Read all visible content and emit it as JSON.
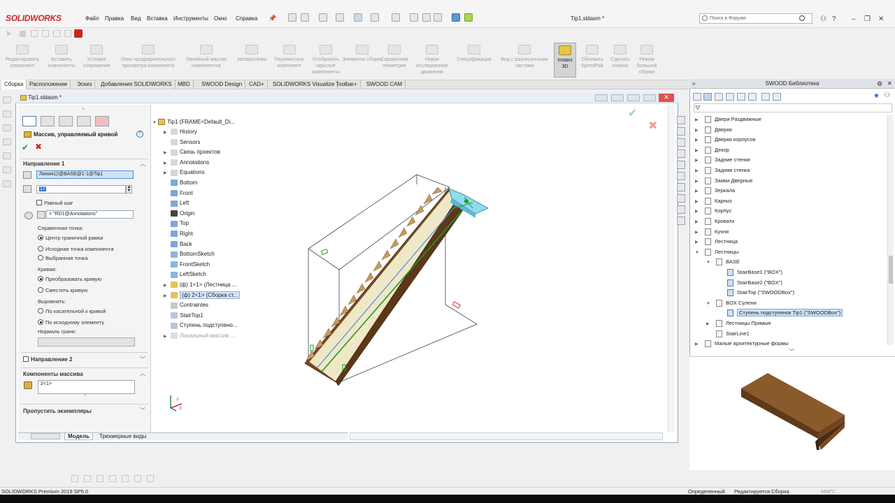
{
  "app": {
    "brand": "SOLIDWORKS",
    "doc_title": "Tip1.sldasm *",
    "menus": [
      "Файл",
      "Правка",
      "Вид",
      "Вставка",
      "Инструменты",
      "Окно",
      "Справка"
    ],
    "search_placeholder": "Поиск в Форуме"
  },
  "command_manager": {
    "buttons": [
      "Редактировать компонент",
      "Вставить компоненты",
      "Условия сопряжения",
      "Окно предварительного просмотра компонента",
      "Линейный массив компонентов",
      "Автокрепежи",
      "Переместить компонент",
      "Отобразить скрытые компоненты",
      "Элементы сборки",
      "Справочная геометрия",
      "Новое исследование движения",
      "Спецификация",
      "Вид с разнесенными частями",
      "Instant 3D",
      "Обновить SpeedPak",
      "Сделать снимок",
      "Режим большой сборки"
    ],
    "active": "Instant 3D"
  },
  "tabs": [
    "Сборка",
    "Расположение",
    "Эскиз",
    "Добавления SOLIDWORKS",
    "MBD",
    "SWOOD Design",
    "CAD+",
    "SOLIDWORKS Visualize",
    "Toolbar+",
    "SWOOD CAM"
  ],
  "active_tab": "Сборка",
  "doc_window": {
    "title": "Tip1.sldasm *"
  },
  "property_manager": {
    "title": "Массив, управляемый кривой",
    "direction1": {
      "label": "Направление 1",
      "curve": "Линия12@BASE@1-1@Tip1",
      "count": "17",
      "equal_spacing": "Равный шаг",
      "equal_spacing_checked": false,
      "distance_value": "= \"RD1@Annotations\"",
      "reference_point_label": "Справочная точка:",
      "ref_options": [
        "Центр граничной рамки",
        "Исходная точка компонента",
        "Выбранная точка"
      ],
      "ref_selected": 0,
      "curve_label": "Кривая:",
      "curve_options": [
        "Преобразовать кривую",
        "Сместить кривую"
      ],
      "curve_selected": 0,
      "align_label": "Выровнять:",
      "align_options": [
        "По касательной к кривой",
        "По исходному элементу"
      ],
      "align_selected": 1,
      "face_normal_label": "Нормаль грани:"
    },
    "direction2": {
      "label": "Направление 2",
      "checked": false
    },
    "components": {
      "label": "Компоненты массива",
      "value": "2<1>"
    },
    "skip": {
      "label": "Пропустить экземпляры"
    }
  },
  "feature_tree": {
    "root": "Tip1  (FRAME<Default_Di...",
    "items": [
      {
        "label": "History",
        "expand": true,
        "icon": "history"
      },
      {
        "label": "Sensors",
        "expand": false,
        "icon": "sensor"
      },
      {
        "label": "Связь проектов",
        "expand": true,
        "icon": "link"
      },
      {
        "label": "Annotations",
        "expand": true,
        "icon": "annotation"
      },
      {
        "label": "Equations",
        "expand": true,
        "icon": "equation"
      },
      {
        "label": "Bottom",
        "expand": false,
        "icon": "plane"
      },
      {
        "label": "Front",
        "expand": false,
        "icon": "plane"
      },
      {
        "label": "Left",
        "expand": false,
        "icon": "plane"
      },
      {
        "label": "Origin",
        "expand": false,
        "icon": "origin"
      },
      {
        "label": "Top",
        "expand": false,
        "icon": "plane"
      },
      {
        "label": "Right",
        "expand": false,
        "icon": "plane"
      },
      {
        "label": "Back",
        "expand": false,
        "icon": "plane"
      },
      {
        "label": "BottomSketch",
        "expand": false,
        "icon": "sketch"
      },
      {
        "label": "FrontSketch",
        "expand": false,
        "icon": "sketch"
      },
      {
        "label": "LeftSketch",
        "expand": false,
        "icon": "sketch"
      },
      {
        "label": "(ф) 1<1> (Лестница ...",
        "expand": true,
        "icon": "assembly"
      },
      {
        "label": "(ф) 2<1> (Сборка ст...",
        "expand": true,
        "icon": "assembly",
        "selected": true
      },
      {
        "label": "Contraintes",
        "expand": false,
        "icon": "mate"
      },
      {
        "label": "StairTop1",
        "expand": false,
        "icon": "part"
      },
      {
        "label": "Ступень подступено...",
        "expand": false,
        "icon": "part"
      },
      {
        "label": "Локальный массив ...",
        "expand": true,
        "icon": "pattern",
        "dim": true
      }
    ]
  },
  "bottom_tabs": [
    "Модель",
    "Трехмерные виды"
  ],
  "active_bottom_tab": "Модель",
  "swood_panel": {
    "title": "SWOOD Библиотека",
    "items": [
      {
        "label": "Двери Раздвижные",
        "level": 0,
        "expand": "closed"
      },
      {
        "label": "Дверки",
        "level": 0,
        "expand": "closed"
      },
      {
        "label": "Дверки корпусов",
        "level": 0,
        "expand": "closed"
      },
      {
        "label": "Декор",
        "level": 0,
        "expand": "closed"
      },
      {
        "label": "Задние стенки",
        "level": 0,
        "expand": "closed"
      },
      {
        "label": "Задняя стенка",
        "level": 0,
        "expand": "closed"
      },
      {
        "label": "Замки Дверные",
        "level": 0,
        "expand": "closed"
      },
      {
        "label": "Зеркала",
        "level": 0,
        "expand": "closed"
      },
      {
        "label": "Карниз",
        "level": 0,
        "expand": "closed"
      },
      {
        "label": "Корпус",
        "level": 0,
        "expand": "closed"
      },
      {
        "label": "Кровати",
        "level": 0,
        "expand": "closed"
      },
      {
        "label": "Кухня",
        "level": 0,
        "expand": "closed"
      },
      {
        "label": "Лестница",
        "level": 0,
        "expand": "closed"
      },
      {
        "label": "Лестницы",
        "level": 0,
        "expand": "open"
      },
      {
        "label": "BASE",
        "level": 1,
        "expand": "open"
      },
      {
        "label": "StairBase1 (\"BOX\")",
        "level": 2,
        "expand": "none"
      },
      {
        "label": "StairBase2 (\"BOX\")",
        "level": 2,
        "expand": "none"
      },
      {
        "label": "StairTop (\"SWOODBox\")",
        "level": 2,
        "expand": "none"
      },
      {
        "label": "BOX Сулени",
        "level": 1,
        "expand": "open"
      },
      {
        "label": "Ступень подступенок Tip1 (\"SWOODBox\")",
        "level": 2,
        "expand": "none",
        "selected": true
      },
      {
        "label": "Лестницы Прямые",
        "level": 1,
        "expand": "closed"
      },
      {
        "label": "StairLine1",
        "level": 1,
        "expand": "none"
      },
      {
        "label": "Малые архитектурные формы",
        "level": 0,
        "expand": "closed"
      }
    ]
  },
  "status_bar": {
    "left": "SOLIDWORKS Premium 2019 SP5.0",
    "state": "Определенный",
    "editing": "Редактируется Сборка",
    "units": "ММГС"
  },
  "colors": {
    "accent": "#3b78d8",
    "ok": "#1e9d33",
    "cancel": "#c62828",
    "wood": "#8b5a2b",
    "curve_green": "#1f9a2a",
    "curve_blue": "#4a90d9"
  }
}
